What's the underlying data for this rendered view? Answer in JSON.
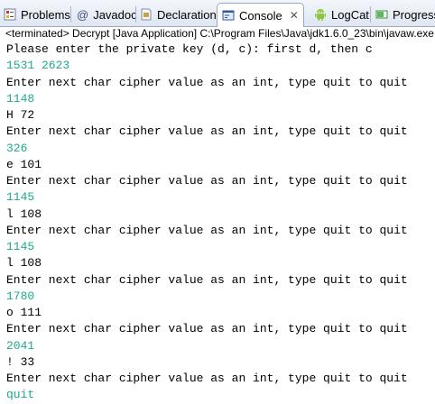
{
  "tabs": [
    {
      "label": "Problems",
      "icon": "problems-icon",
      "active": false
    },
    {
      "label": "Javadoc",
      "icon": "javadoc-icon",
      "active": false
    },
    {
      "label": "Declaration",
      "icon": "declaration-icon",
      "active": false
    },
    {
      "label": "Console",
      "icon": "console-icon",
      "active": true
    },
    {
      "label": "LogCat",
      "icon": "android-icon",
      "active": false
    },
    {
      "label": "Progress",
      "icon": "progress-icon",
      "active": false
    }
  ],
  "console_status": "<terminated> Decrypt [Java Application] C:\\Program Files\\Java\\jdk1.6.0_23\\bin\\javaw.exe",
  "colors": {
    "output": "#000000",
    "user_input": "#1fa98c",
    "tab_border": "#9aa9bf"
  },
  "console_lines": [
    {
      "text": "Please enter the private key (d, c): first d, then c",
      "kind": "output"
    },
    {
      "text": "1531 2623",
      "kind": "input"
    },
    {
      "text": "Enter next char cipher value as an int, type quit to quit",
      "kind": "output"
    },
    {
      "text": "1148",
      "kind": "input"
    },
    {
      "text": "H 72",
      "kind": "output"
    },
    {
      "text": "Enter next char cipher value as an int, type quit to quit",
      "kind": "output"
    },
    {
      "text": "326",
      "kind": "input"
    },
    {
      "text": "e 101",
      "kind": "output"
    },
    {
      "text": "Enter next char cipher value as an int, type quit to quit",
      "kind": "output"
    },
    {
      "text": "1145",
      "kind": "input"
    },
    {
      "text": "l 108",
      "kind": "output"
    },
    {
      "text": "Enter next char cipher value as an int, type quit to quit",
      "kind": "output"
    },
    {
      "text": "1145",
      "kind": "input"
    },
    {
      "text": "l 108",
      "kind": "output"
    },
    {
      "text": "Enter next char cipher value as an int, type quit to quit",
      "kind": "output"
    },
    {
      "text": "1780",
      "kind": "input"
    },
    {
      "text": "o 111",
      "kind": "output"
    },
    {
      "text": "Enter next char cipher value as an int, type quit to quit",
      "kind": "output"
    },
    {
      "text": "2041",
      "kind": "input"
    },
    {
      "text": "! 33",
      "kind": "output"
    },
    {
      "text": "Enter next char cipher value as an int, type quit to quit",
      "kind": "output"
    },
    {
      "text": "quit",
      "kind": "input"
    }
  ]
}
